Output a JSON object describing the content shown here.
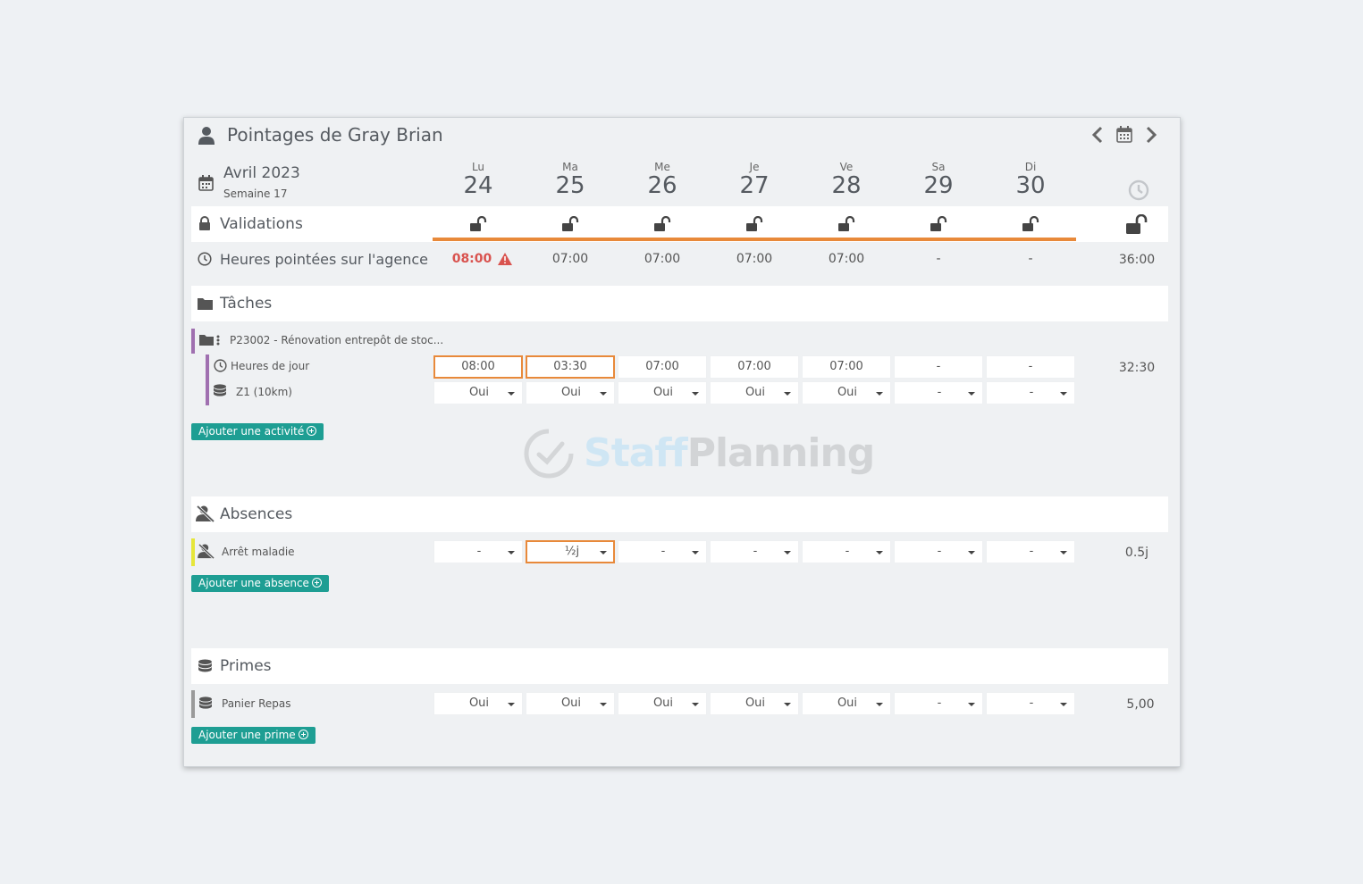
{
  "header": {
    "title": "Pointages de Gray Brian"
  },
  "period": {
    "month": "Avril 2023",
    "week": "Semaine 17"
  },
  "days": [
    {
      "abbr": "Lu",
      "num": "24"
    },
    {
      "abbr": "Ma",
      "num": "25"
    },
    {
      "abbr": "Me",
      "num": "26"
    },
    {
      "abbr": "Je",
      "num": "27"
    },
    {
      "abbr": "Ve",
      "num": "28"
    },
    {
      "abbr": "Sa",
      "num": "29"
    },
    {
      "abbr": "Di",
      "num": "30"
    }
  ],
  "validations": {
    "label": "Validations"
  },
  "hours_agency": {
    "label": "Heures pointées sur l'agence",
    "values": [
      "08:00",
      "07:00",
      "07:00",
      "07:00",
      "07:00",
      "-",
      "-"
    ],
    "total": "36:00",
    "alert_color": "#d9534f"
  },
  "tasks": {
    "title": "Tâches",
    "project": "P23002 - Rénovation entrepôt de stoc...",
    "day_hours": {
      "label": "Heures de jour",
      "values": [
        "08:00",
        "03:30",
        "07:00",
        "07:00",
        "07:00",
        "-",
        "-"
      ],
      "total": "32:30"
    },
    "zone": {
      "label": "Z1 (10km)",
      "values": [
        "Oui",
        "Oui",
        "Oui",
        "Oui",
        "Oui",
        "-",
        "-"
      ]
    },
    "add_label": "Ajouter une activité"
  },
  "watermark": {
    "part1": "Staff",
    "part2": "Planning"
  },
  "absences": {
    "title": "Absences",
    "row": {
      "label": "Arrêt maladie",
      "values": [
        "-",
        "½j",
        "-",
        "-",
        "-",
        "-",
        "-"
      ],
      "total": "0.5j"
    },
    "add_label": "Ajouter une absence"
  },
  "primes": {
    "title": "Primes",
    "row": {
      "label": "Panier Repas",
      "values": [
        "Oui",
        "Oui",
        "Oui",
        "Oui",
        "Oui",
        "-",
        "-"
      ],
      "total": "5,00"
    },
    "add_label": "Ajouter une prime"
  },
  "colors": {
    "accent_orange": "#e8893a",
    "teal": "#1e9e93",
    "task_bar": "#a070b0",
    "absence_bar": "#e6e63a",
    "prime_bar": "#9a9a9a"
  }
}
